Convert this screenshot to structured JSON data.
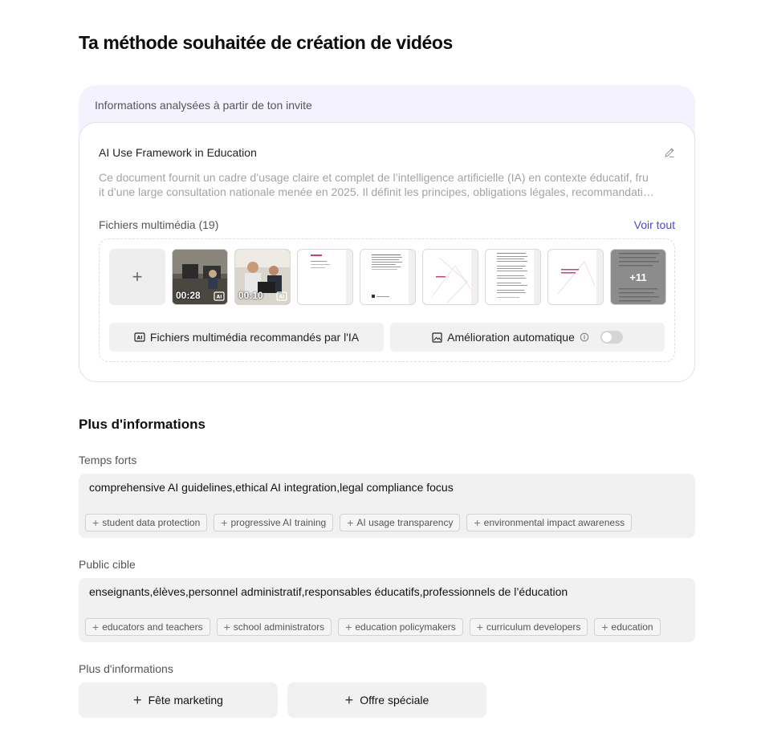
{
  "page": {
    "title": "Ta méthode souhaitée de création de vidéos"
  },
  "analysis": {
    "header": "Informations analysées à partir de ton invite",
    "doc_title": "AI Use Framework in Education",
    "doc_desc_line1": "Ce document fournit un cadre d’usage claire et complet de l’intelligence artificielle (IA) en contexte éducatif, fru",
    "doc_desc_line2": "it d’une large consultation nationale menée en 2025. Il définit les principes, obligations légales, recommandati…",
    "media_label": "Fichiers multimédia (19)",
    "see_all": "Voir tout",
    "videos": [
      {
        "duration": "00:28"
      },
      {
        "duration": "00:10"
      }
    ],
    "more_count": "+11",
    "ai_button": "Fichiers multimédia recommandés par l'IA",
    "enhance_label": "Amélioration automatique",
    "enhance_enabled": false
  },
  "more_info": {
    "title": "Plus d'informations",
    "highlights": {
      "label": "Temps forts",
      "value": "comprehensive AI guidelines,ethical AI integration,legal compliance focus",
      "suggestions": [
        "student data protection",
        "progressive AI training",
        "AI usage transparency",
        "environmental impact awareness"
      ]
    },
    "audience": {
      "label": "Public cible",
      "value": "enseignants,élèves,personnel administratif,responsables éducatifs,professionnels de l’éducation",
      "suggestions": [
        "educators and teachers",
        "school administrators",
        "education policymakers",
        "curriculum developers",
        "education"
      ]
    },
    "extra": {
      "label": "Plus d'informations",
      "buttons": [
        "Fête marketing",
        "Offre spéciale"
      ]
    }
  }
}
